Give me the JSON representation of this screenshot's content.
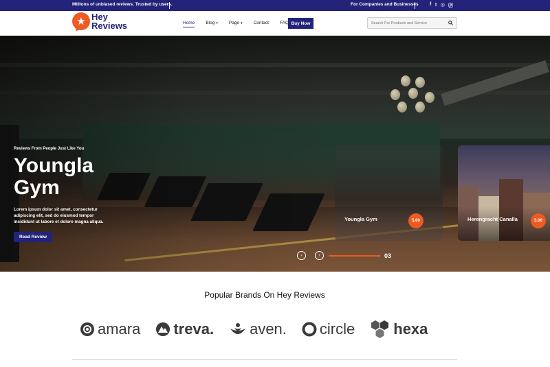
{
  "topbar": {
    "tagline": "Millions of unbiased reviews. Trusted by users.",
    "business_link": "For Companies and Businesses",
    "social_icons": [
      "facebook-icon",
      "twitter-icon",
      "instagram-icon",
      "pinterest-icon"
    ],
    "social_glyphs": [
      "f",
      "𝕥",
      "◎",
      "ⓟ"
    ]
  },
  "header": {
    "logo_line1": "Hey",
    "logo_line2": "Reviews",
    "nav": [
      {
        "label": "Home",
        "active": true,
        "dropdown": false
      },
      {
        "label": "Blog",
        "active": false,
        "dropdown": true
      },
      {
        "label": "Page",
        "active": false,
        "dropdown": true
      },
      {
        "label": "Contact",
        "active": false,
        "dropdown": false
      },
      {
        "label": "FAQ",
        "active": false,
        "dropdown": false
      }
    ],
    "buy_label": "Buy Now",
    "search_placeholder": "Search For Products and Service"
  },
  "hero": {
    "kicker": "Reviews From People Just Like You",
    "title_line1": "Youngla",
    "title_line2": "Gym",
    "description": "Lorem ipsum dolor sit amet, consectetur adipiscing elit, sed do eiusmod tempor incididunt ut labore et dolore magna aliqua.",
    "read_label": "Read Review",
    "cards": [
      {
        "name": "Youngla Gym",
        "score": "5.00"
      },
      {
        "name": "Herengracht Canalla",
        "score": "5.00"
      }
    ],
    "slide_number": "03",
    "progress": 0.97
  },
  "brands": {
    "title": "Popular Brands On Hey Reviews",
    "items": [
      {
        "name": "amara",
        "icon": "at-circle-icon"
      },
      {
        "name": "treva.",
        "icon": "mountain-circle-icon"
      },
      {
        "name": "aven.",
        "icon": "lotus-icon"
      },
      {
        "name": "circle",
        "icon": "ring-icon"
      },
      {
        "name": "hexa",
        "icon": "hexagons-icon"
      }
    ]
  },
  "colors": {
    "brand_navy": "#23237a",
    "accent_orange": "#ec5b24"
  }
}
